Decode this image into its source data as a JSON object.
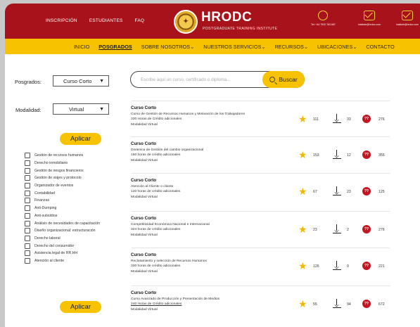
{
  "header": {
    "nav": [
      "INSCRIPCIÓN",
      "ESTUDIANTES",
      "FAQ"
    ],
    "brand": "HRODC",
    "brand_sub": "POSTGRADUATE TRAINING INSTITUTE",
    "contacts": [
      {
        "icon": "whatsapp-icon",
        "text": "Tel: +44 7932 763 687"
      },
      {
        "icon": "mail-icon",
        "text": "institute@hrdoc.com"
      },
      {
        "icon": "mail-icon",
        "text": "institute@hrdoc.com"
      }
    ]
  },
  "main_nav": {
    "items": [
      "INICIO",
      "POSGRADOS",
      "SOBRE NOSOTROS⌄",
      "NUESTROS SERVICIOS⌄",
      "RECURSOS⌄",
      "UBICACIONES⌄",
      "CONTACTO"
    ],
    "active": "POSGRADOS"
  },
  "filters": {
    "posgrados_label": "Posgrados:",
    "posgrados_value": "Curso Corto",
    "modalidad_label": "Modalidad:",
    "modalidad_value": "Virtual",
    "apply_label": "Aplicar",
    "categories": [
      "Gestión de recursos humanos",
      "Derecho inmobiliario",
      "Gestión de riesgos financieros",
      "Gestión de viajes y protocolo",
      "Organizador de eventos",
      "Contabilidad",
      "Finanzas",
      "Anti-Dumping",
      "Anti-subsidios",
      "Análisis de necesidades de capacitación",
      "Diseño organizacional: estructuración",
      "Derecho laboral",
      "Derecho del consumidor",
      "Asistencia legal de RR.HH",
      "Atención al cliente"
    ]
  },
  "search": {
    "placeholder": "Escribe aquí un curso, certificado o diploma...",
    "button_label": "Buscar"
  },
  "results": [
    {
      "type": "Curso Corto",
      "title": "Curso de Gestión de Recursos Humanos y Motivación de los Trabajadores",
      "credits": "330 Horas de Crédito adicionales",
      "mode": "Modalidad Virtual",
      "stars": "111",
      "downloads": "33",
      "questions": "276"
    },
    {
      "type": "Curso Corto",
      "title": "Dinámica de Gestión del cambio organizacional",
      "credits": "150 horas de crédito adicionales",
      "mode": "Modalidad Virtual",
      "stars": "153",
      "downloads": "12",
      "questions": "355"
    },
    {
      "type": "Curso Corto",
      "title": "Atención al Cliente o cliente",
      "credits": "120 horas de crédito adicionales",
      "mode": "Modalidad Virtual",
      "stars": "67",
      "downloads": "23",
      "questions": "125"
    },
    {
      "type": "Curso Corto",
      "title": "Competitividad Económica Nacional e Internacional",
      "credits": "324 horas de crédito adicionales",
      "mode": "Modalidad Virtual",
      "stars": "23",
      "downloads": "2",
      "questions": "276"
    },
    {
      "type": "Curso Corto",
      "title": "Reclutamiento y selección de Recursos Humanos",
      "credits": "330 horas de crédito adicionales",
      "mode": "Modalidad Virtual",
      "stars": "126",
      "downloads": "0",
      "questions": "221"
    },
    {
      "type": "Curso Corto",
      "title": "Curso Avanzado de Producción y Presentación de Medios",
      "credits": "240 Horas de Crédito adicionales",
      "mode": "Modalidad Virtual",
      "stars": "55",
      "downloads": "94",
      "questions": "672"
    }
  ],
  "colors": {
    "brand_red": "#a8121a",
    "accent_yellow": "#f7c200",
    "badge_red": "#c01722",
    "star": "#f2b705"
  }
}
